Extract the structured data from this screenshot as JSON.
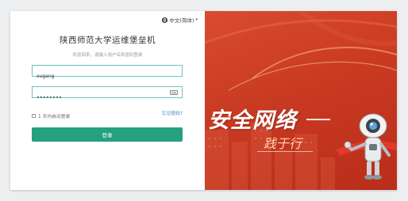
{
  "lang": {
    "label": "中文(简体)",
    "caret": "▾"
  },
  "login": {
    "title": "陕西师范大学运维堡垒机",
    "subtitle": "欢迎回来，请输入用户名和密码登录",
    "username_value": "xugang",
    "password_value": "••••••••",
    "remember_label": "1 天内自动登录",
    "forgot_label": "忘记密码?",
    "submit_label": "登录"
  },
  "banner": {
    "slogan_main": "安全网络",
    "slogan_sub": "践于行"
  },
  "colors": {
    "accent": "#26a17f",
    "banner_red": "#c93a22",
    "link": "#3a7fc4"
  }
}
